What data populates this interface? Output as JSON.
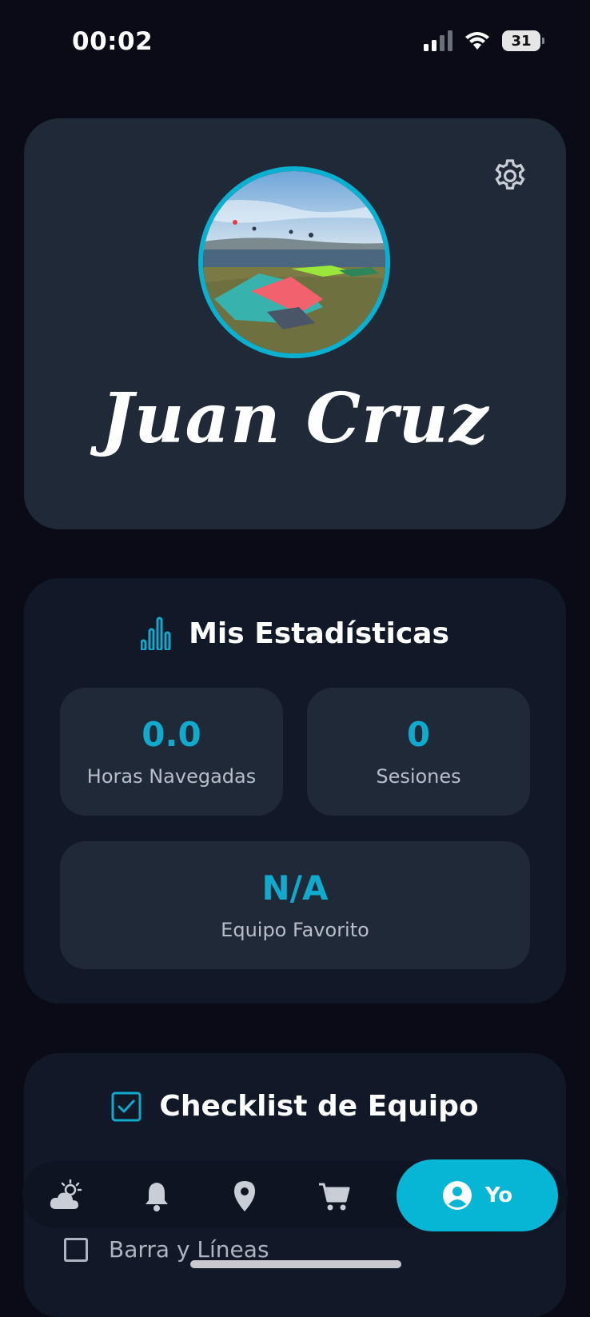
{
  "status": {
    "time": "00:02",
    "battery": "31"
  },
  "profile": {
    "name": "Juan Cruz"
  },
  "stats": {
    "title": "Mis Estadísticas",
    "hours_value": "0.0",
    "hours_label": "Horas Navegadas",
    "sessions_value": "0",
    "sessions_label": "Sesiones",
    "favorite_value": "N/A",
    "favorite_label": "Equipo Favorito"
  },
  "checklist": {
    "title": "Checklist de Equipo",
    "items": [
      {
        "label": "Barra y Líneas",
        "checked": false
      }
    ]
  },
  "nav": {
    "items": [
      "cloud-sun-icon",
      "bell-icon",
      "map-pin-icon",
      "cart-icon",
      "user-icon"
    ],
    "active_label": "Yo"
  },
  "colors": {
    "accent": "#06b6d4",
    "card": "#1f2937",
    "card_dark": "#111827",
    "background": "#0a0b17"
  }
}
